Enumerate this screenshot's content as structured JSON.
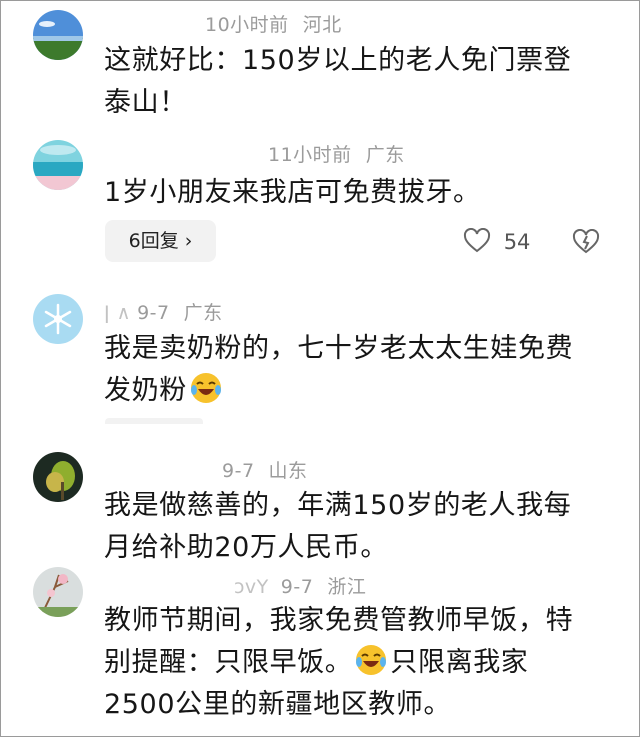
{
  "comments": [
    {
      "time": "10小时前",
      "region": "河北",
      "text": [
        "这就好比：150岁以上的老人免门票登",
        "泰山！"
      ]
    },
    {
      "time": "11小时前",
      "region": "广东",
      "text": [
        "1岁小朋友来我店可免费拔牙。"
      ],
      "replies_label": "6回复 ›",
      "likes": "54"
    },
    {
      "nick_fragment": "ǀ      ∧",
      "time": "9-7",
      "region": "广东",
      "text": [
        "我是卖奶粉的，七十岁老太太生娃免费",
        "发奶粉"
      ]
    },
    {
      "time": "9-7",
      "region": "山东",
      "text": [
        "我是做慈善的，年满150岁的老人我每",
        "月给补助20万人民币。"
      ]
    },
    {
      "nick_fragment": "ɔvY",
      "time": "9-7",
      "region": "浙江",
      "text": [
        "教师节期间，我家免费管教师早饭，特",
        "别提醒：只限早饭。",
        "只限离我家",
        "2500公里的新疆地区教师。"
      ]
    }
  ],
  "icons": {
    "like": "heart-outline-icon",
    "dislike": "broken-heart-icon",
    "emoji": "laughing-crying-emoji"
  }
}
